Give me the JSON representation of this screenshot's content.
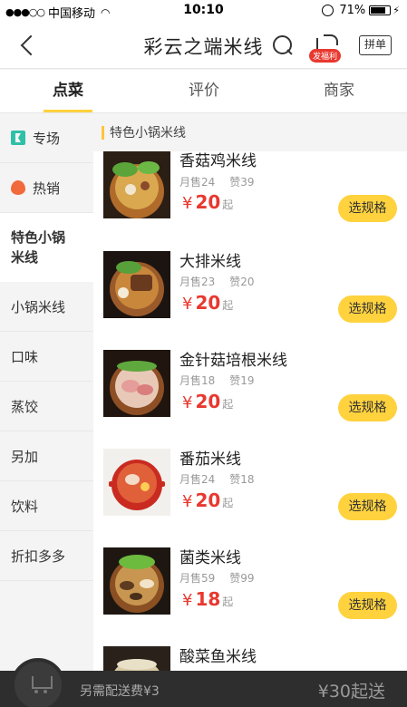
{
  "status_bar": {
    "carrier": "中国移动",
    "time": "10:10",
    "battery": "71%"
  },
  "nav": {
    "title": "彩云之端米线",
    "share_badge": "发福利",
    "group_label": "拼单"
  },
  "tabs": [
    {
      "label": "点菜",
      "active": true
    },
    {
      "label": "评价",
      "active": false
    },
    {
      "label": "商家",
      "active": false
    }
  ],
  "sidebar": [
    {
      "label": "专场",
      "icon": "flag-icon"
    },
    {
      "label": "热销",
      "icon": "fire-icon"
    },
    {
      "label": "特色小锅\n米线",
      "active": true
    },
    {
      "label": "小锅米线"
    },
    {
      "label": "口味"
    },
    {
      "label": "蒸饺"
    },
    {
      "label": "另加"
    },
    {
      "label": "饮料"
    },
    {
      "label": "折扣多多"
    }
  ],
  "section_title": "特色小锅米线",
  "items": [
    {
      "name": "香菇鸡米线",
      "sold": "月售24",
      "likes": "赞39",
      "price_symbol": "¥",
      "price": "20",
      "unit": "起",
      "button": "选规格"
    },
    {
      "name": "大排米线",
      "sold": "月售23",
      "likes": "赞20",
      "price_symbol": "¥",
      "price": "20",
      "unit": "起",
      "button": "选规格"
    },
    {
      "name": "金针菇培根米线",
      "sold": "月售18",
      "likes": "赞19",
      "price_symbol": "¥",
      "price": "20",
      "unit": "起",
      "button": "选规格"
    },
    {
      "name": "番茄米线",
      "sold": "月售24",
      "likes": "赞18",
      "price_symbol": "¥",
      "price": "20",
      "unit": "起",
      "button": "选规格"
    },
    {
      "name": "菌类米线",
      "sold": "月售59",
      "likes": "赞99",
      "price_symbol": "¥",
      "price": "18",
      "unit": "起",
      "button": "选规格"
    },
    {
      "name": "酸菜鱼米线",
      "sold": "",
      "likes": "",
      "price_symbol": "",
      "price": "",
      "unit": "",
      "button": ""
    }
  ],
  "bottom_bar": {
    "delivery_text": "另需配送费¥3",
    "min_order": "¥30起送"
  },
  "colors": {
    "accent": "#ffd23e",
    "price": "#e8382f",
    "bottom_bg": "#2e2e2e"
  }
}
